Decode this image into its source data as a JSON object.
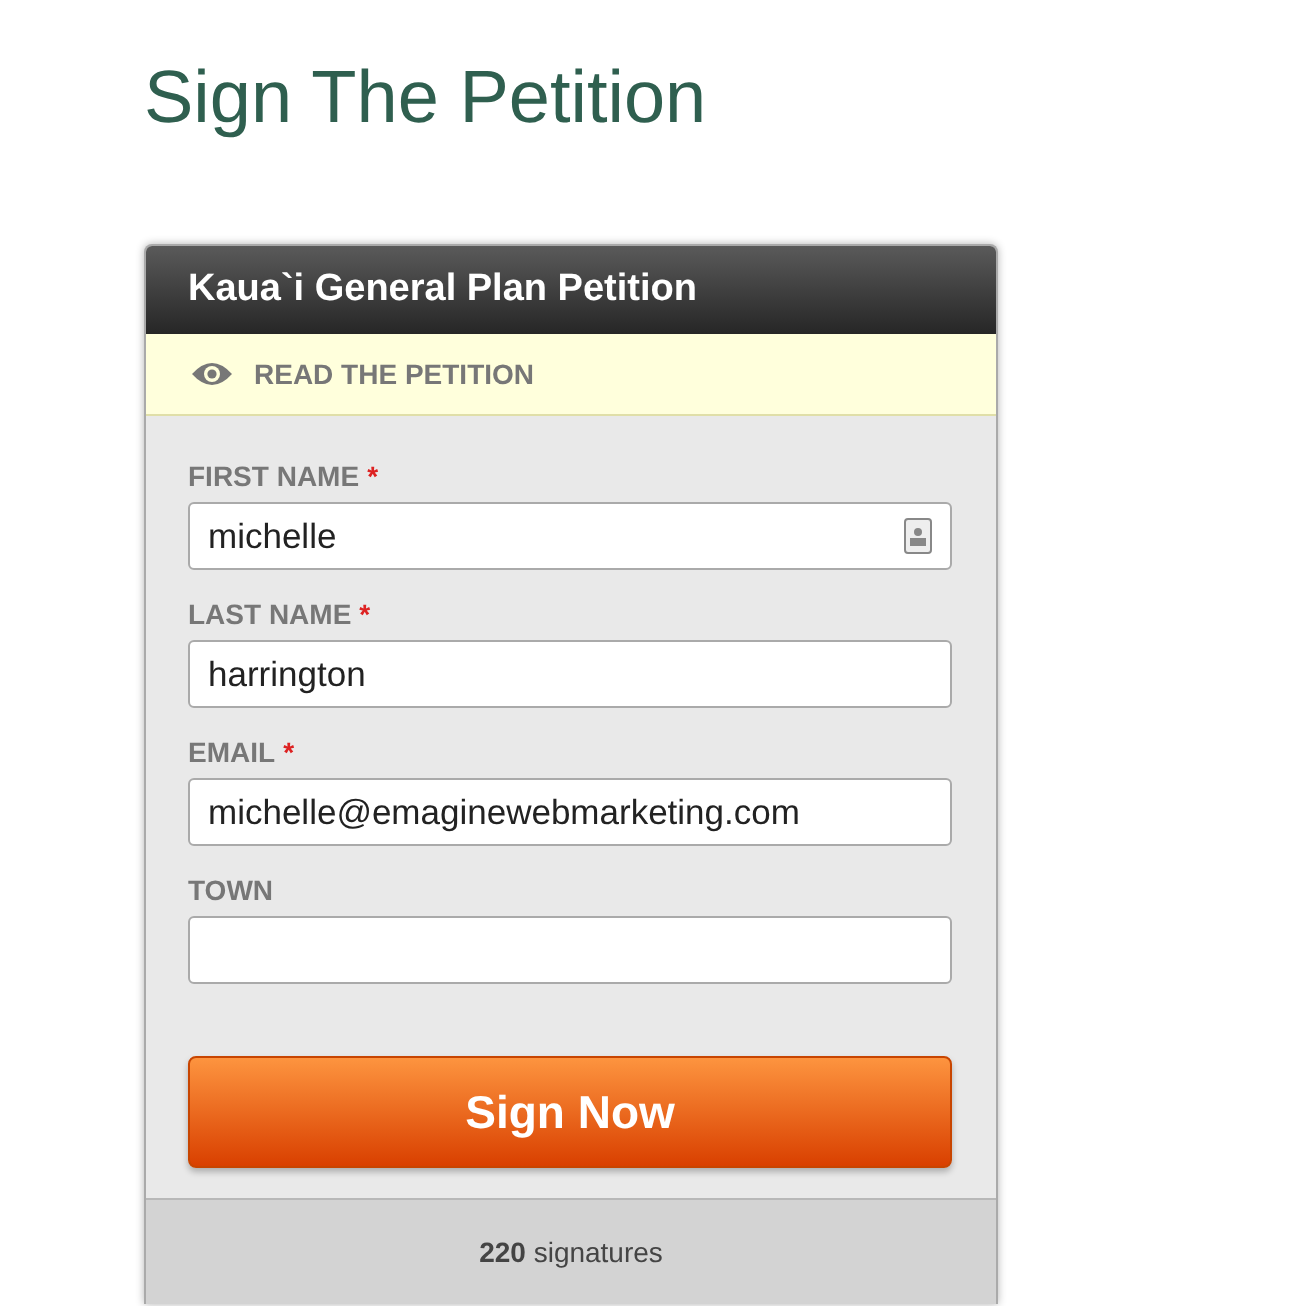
{
  "page_title": "Sign The Petition",
  "card": {
    "title": "Kaua`i General Plan Petition",
    "read_link": "READ THE PETITION",
    "fields": [
      {
        "label": "FIRST NAME",
        "required_mark": "*",
        "value": "michelle",
        "autofill_icon": true
      },
      {
        "label": "LAST NAME",
        "required_mark": "*",
        "value": "harrington",
        "autofill_icon": false
      },
      {
        "label": "EMAIL",
        "required_mark": "*",
        "value": "michelle@emaginewebmarketing.com",
        "autofill_icon": false
      },
      {
        "label": "TOWN",
        "autofill_icon": false
      }
    ],
    "submit": "Sign Now",
    "signatures": "**220** signatures"
  }
}
